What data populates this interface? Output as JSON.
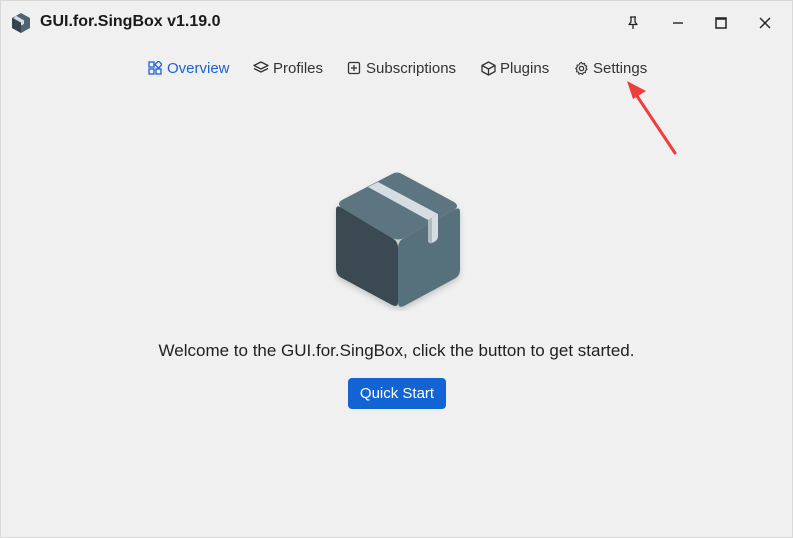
{
  "window": {
    "title": "GUI.for.SingBox v1.19.0"
  },
  "nav": {
    "items": [
      {
        "label": "Overview",
        "icon": "grid-icon",
        "active": true
      },
      {
        "label": "Profiles",
        "icon": "layers-icon",
        "active": false
      },
      {
        "label": "Subscriptions",
        "icon": "bookmark-add-icon",
        "active": false
      },
      {
        "label": "Plugins",
        "icon": "cube-icon",
        "active": false
      },
      {
        "label": "Settings",
        "icon": "gear-icon",
        "active": false
      }
    ]
  },
  "main": {
    "welcome_text": "Welcome to the GUI.for.SingBox, click the button to get started.",
    "quick_start_label": "Quick Start"
  },
  "colors": {
    "accent": "#1264d4",
    "active_nav": "#1d5fd6",
    "background": "#f0f0f0",
    "annotation": "#f03c3c"
  }
}
